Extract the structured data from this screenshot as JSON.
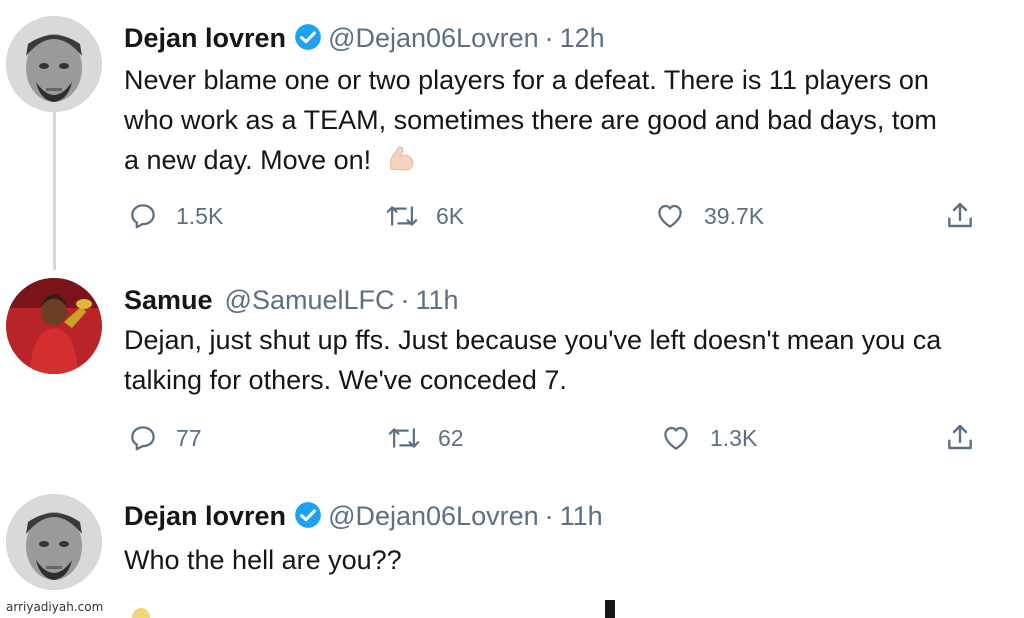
{
  "tweets": [
    {
      "name": "Dejan lovren",
      "verified": true,
      "handle": "@Dejan06Lovren",
      "separator": "·",
      "time": "12h",
      "text_lines": [
        "Never blame one or two players for a defeat. There is 11 players on",
        "who work as a TEAM, sometimes there are good and bad days, tom",
        "a new day. Move on!"
      ],
      "emoji_icon": "flexed-biceps-icon",
      "replies": "1.5K",
      "retweets": "6K",
      "likes": "39.7K"
    },
    {
      "name": "Samue",
      "verified": false,
      "handle": "@SamuelLFC",
      "separator": "·",
      "time": "11h",
      "text_lines": [
        "Dejan, just shut up ffs. Just because you've left doesn't mean you ca",
        "talking for others. We've conceded 7."
      ],
      "replies": "77",
      "retweets": "62",
      "likes": "1.3K"
    },
    {
      "name": "Dejan lovren",
      "verified": true,
      "handle": "@Dejan06Lovren",
      "separator": "·",
      "time": "11h",
      "text_lines": [
        "Who the hell are you??"
      ]
    }
  ],
  "watermark": "arriyadiyah.com",
  "colors": {
    "verified_blue": "#1da1f2",
    "secondary_text": "#5b7083",
    "thread_line": "#cfd9de"
  }
}
